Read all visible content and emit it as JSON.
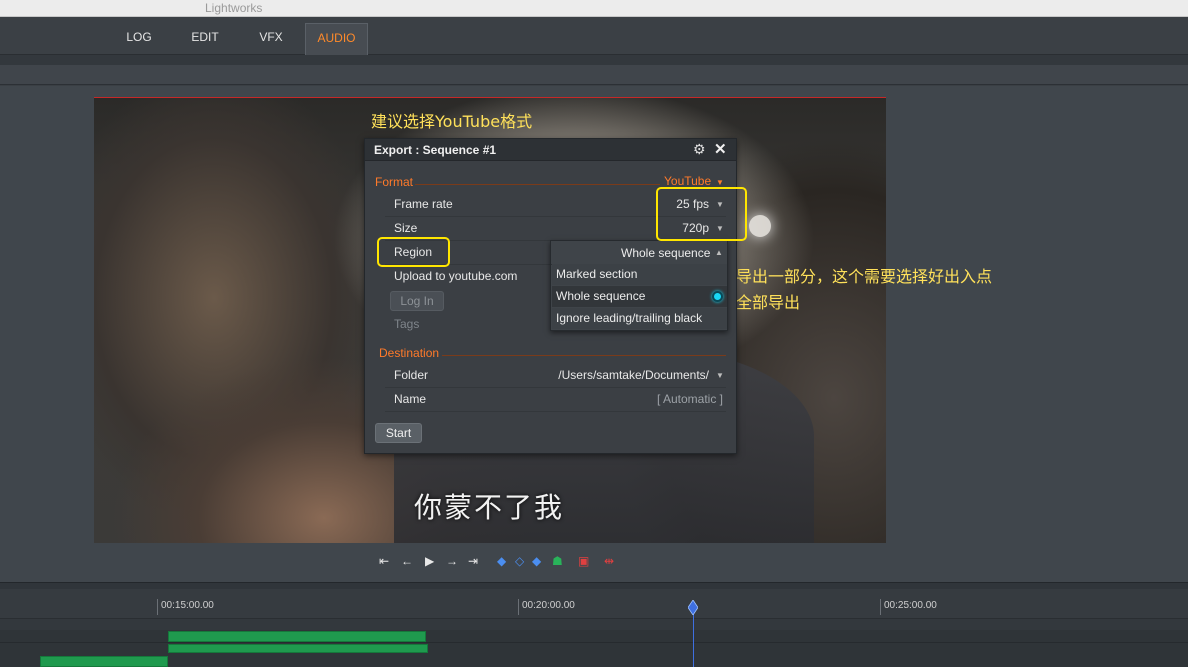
{
  "window": {
    "title": "Lightworks"
  },
  "tabs": [
    {
      "label": "LOG",
      "active": false
    },
    {
      "label": "EDIT",
      "active": false
    },
    {
      "label": "VFX",
      "active": false
    },
    {
      "label": "AUDIO",
      "active": true
    }
  ],
  "viewer": {
    "subtitle": "你蒙不了我"
  },
  "annotations": {
    "top": "建议选择YouTube格式",
    "marked_note": "导出一部分，这个需要选择好出入点",
    "whole_note": "全部导出"
  },
  "export_dialog": {
    "title": "Export : Sequence #1",
    "format": {
      "label": "Format",
      "value": "YouTube"
    },
    "frame_rate": {
      "label": "Frame rate",
      "value": "25 fps"
    },
    "size": {
      "label": "Size",
      "value": "720p"
    },
    "region": {
      "label": "Region",
      "value": "Whole sequence"
    },
    "upload": {
      "label": "Upload to youtube.com"
    },
    "login_button": "Log In",
    "tags": {
      "label": "Tags"
    },
    "destination": {
      "label": "Destination"
    },
    "folder": {
      "label": "Folder",
      "value": "/Users/samtake/Documents/"
    },
    "name": {
      "label": "Name",
      "value": "[ Automatic ]"
    },
    "start_button": "Start"
  },
  "region_dropdown": {
    "options": [
      "Marked section",
      "Whole sequence",
      "Ignore leading/trailing black"
    ],
    "selected": "Whole sequence"
  },
  "timeline": {
    "timecodes": [
      "00:15:00.00",
      "00:20:00.00",
      "00:25:00.00"
    ]
  },
  "colors": {
    "accent": "#ff7a2a",
    "highlight": "#ffe600",
    "clip": "#1f9a4e",
    "playhead": "#3e6fe0"
  }
}
